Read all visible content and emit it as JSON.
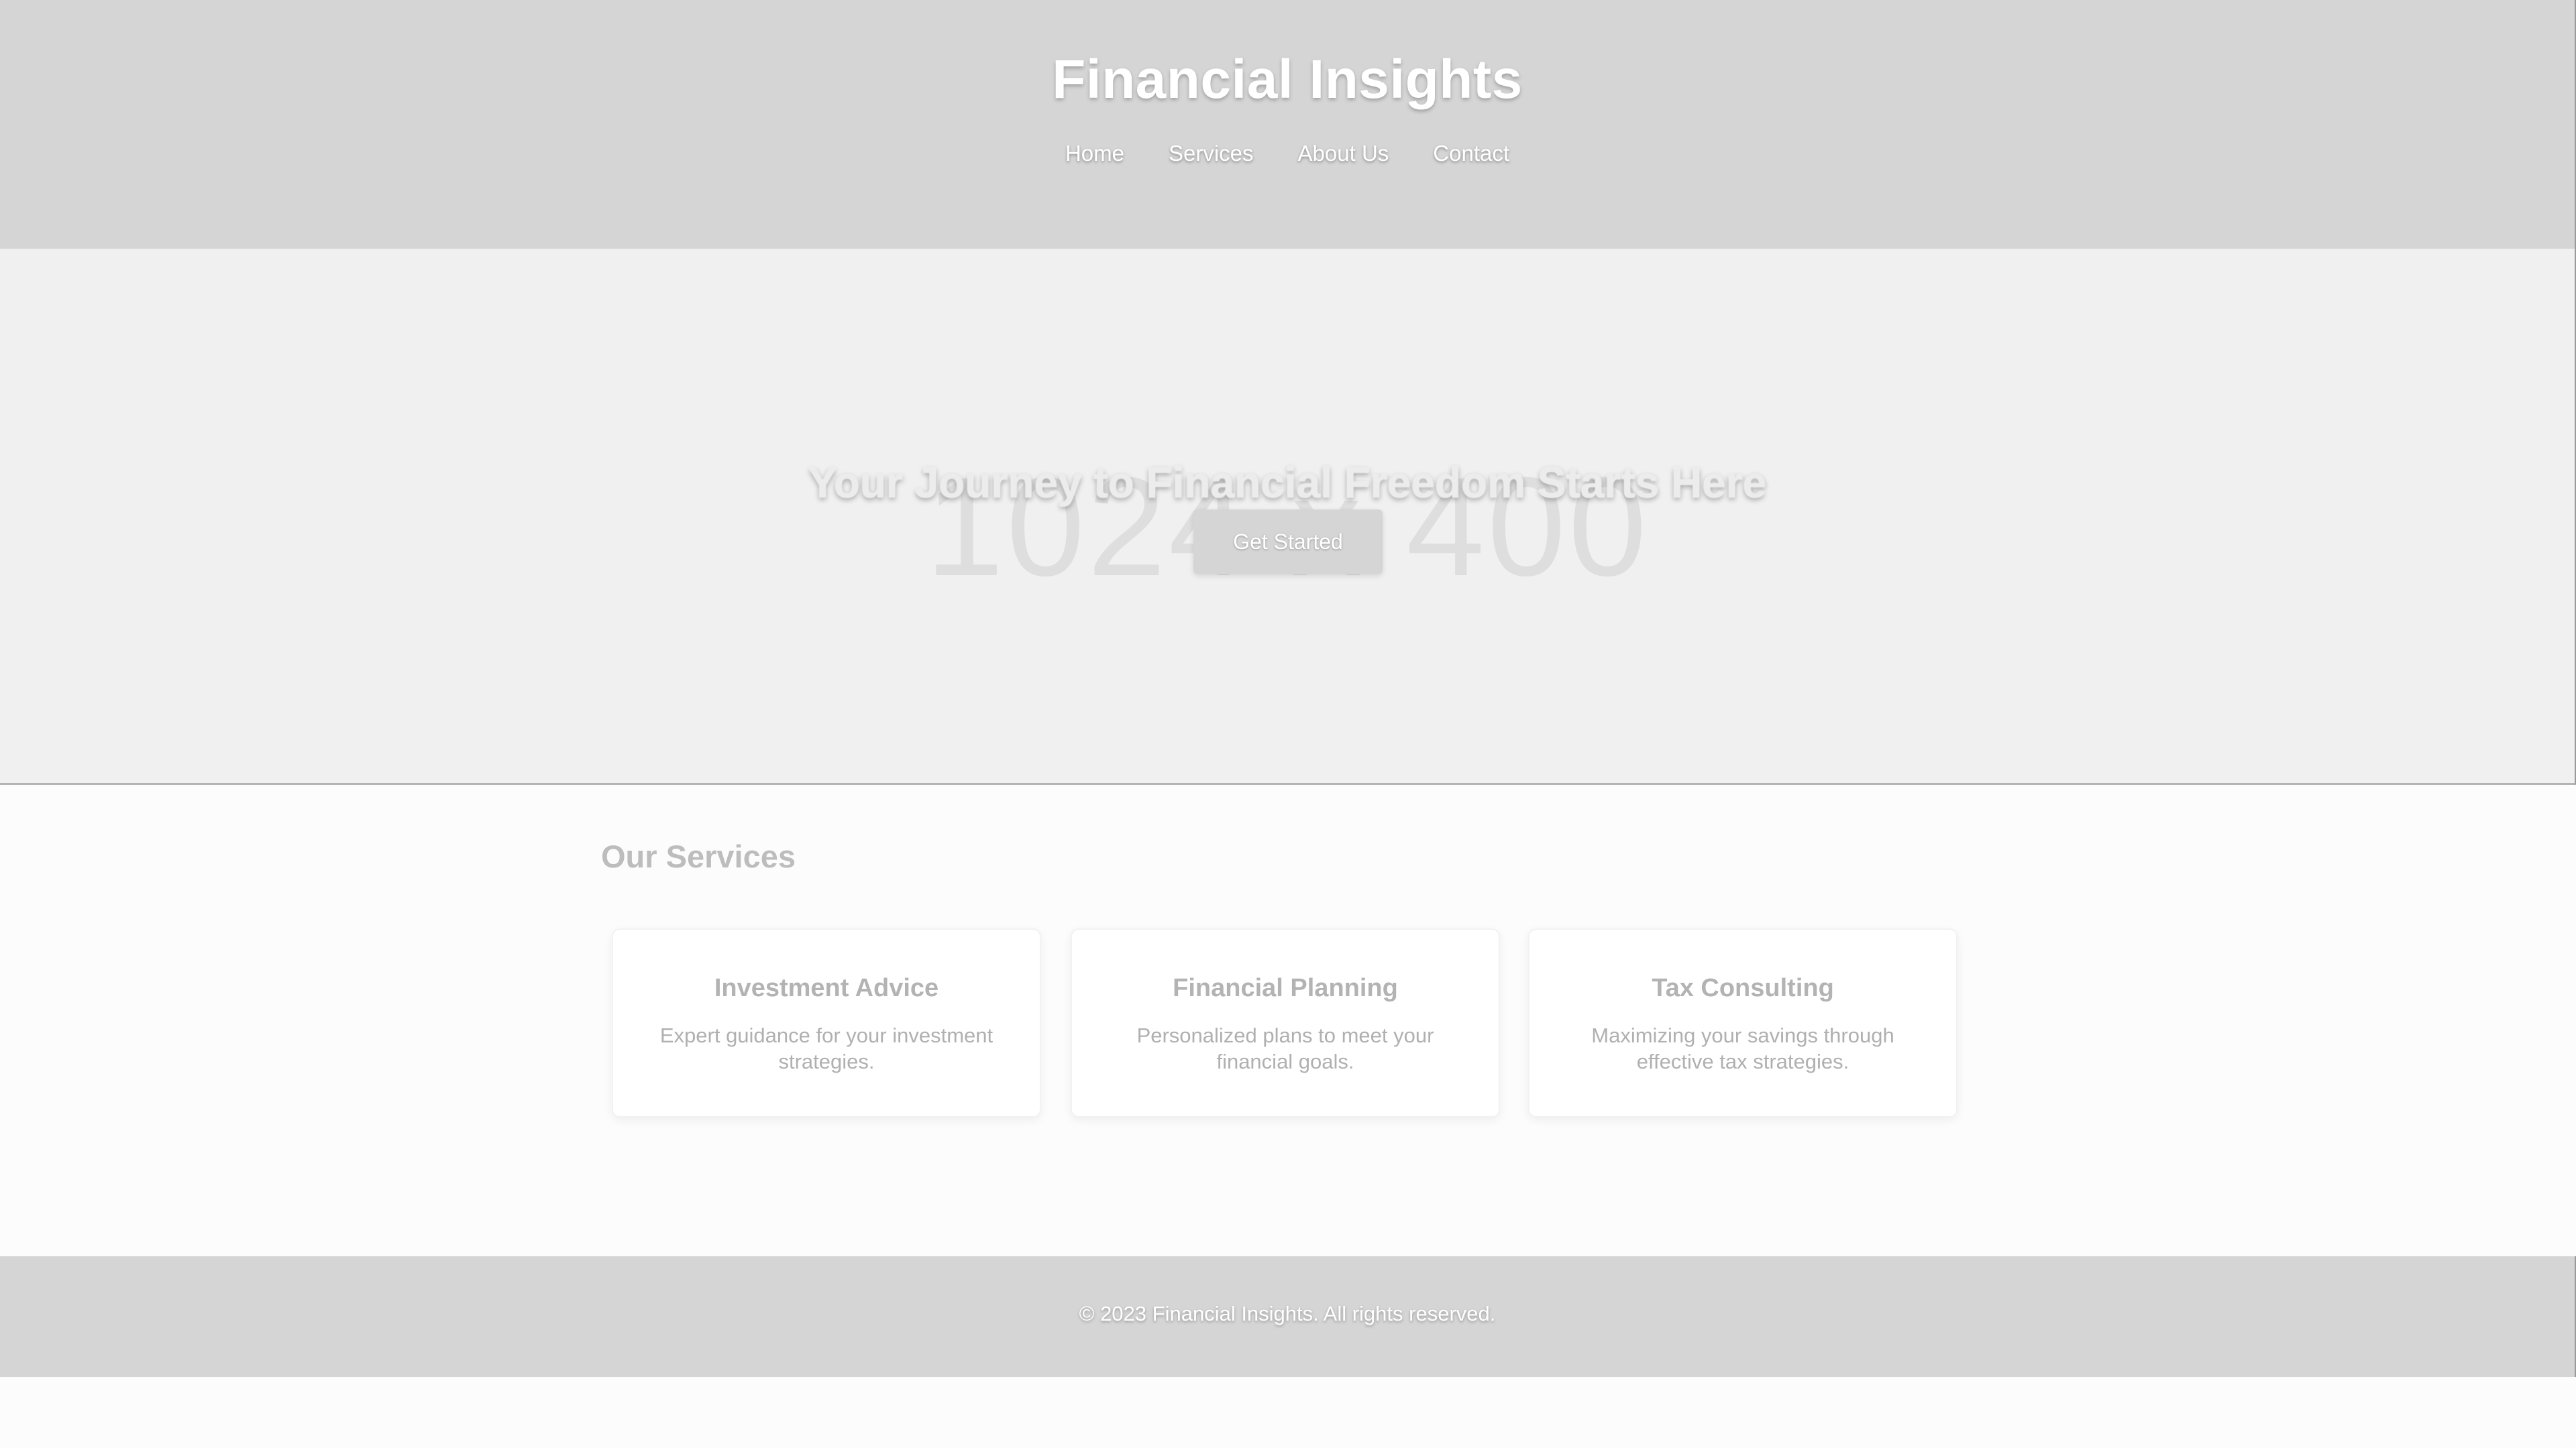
{
  "header": {
    "title": "Financial Insights",
    "nav": [
      "Home",
      "Services",
      "About Us",
      "Contact"
    ]
  },
  "hero": {
    "watermark": "1024 x 400",
    "title": "Your Journey to Financial Freedom Starts Here",
    "button_label": "Get Started"
  },
  "services": {
    "heading": "Our Services",
    "cards": [
      {
        "title": "Investment Advice",
        "text": "Expert guidance for your investment strategies."
      },
      {
        "title": "Financial Planning",
        "text": "Personalized plans to meet your financial goals."
      },
      {
        "title": "Tax Consulting",
        "text": "Maximizing your savings through effective tax strategies."
      }
    ]
  },
  "footer": {
    "text": "© 2023 Financial Insights. All rights reserved."
  },
  "colors": {
    "header_bg": "#d5d5d5",
    "hero_bg": "#f0f0f0",
    "page_bg": "#fcfcfc",
    "button_bg": "#d5d5d5",
    "footer_bg": "#d5d5d5"
  }
}
